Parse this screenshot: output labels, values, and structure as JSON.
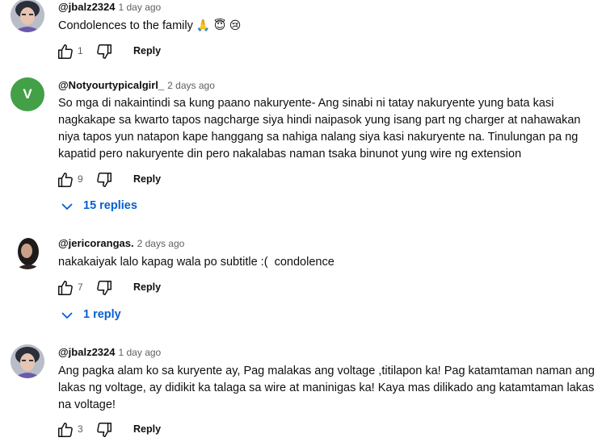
{
  "comments": [
    {
      "author": "@jbalz2324",
      "time": "1 day ago",
      "text": "Condolences to the family",
      "emojis": "🙏 😇 😢",
      "likes": "1",
      "reply_label": "Reply",
      "avatar_icon": "profile-photo"
    },
    {
      "author": "@Notyourtypicalgirl_",
      "time": "2 days ago",
      "avatar_letter": "V",
      "avatar_color": "#43a047",
      "text_lines": [
        "So mga di nakaintindi sa kung paano nakuryente- Ang sinabi ni tatay nakuryente yung bata kasi",
        "nagkakape sa kwarto tapos nagcharge siya hindi naipasok yung isang part ng charger at nahawakan",
        "niya tapos yun natapon kape hanggang sa nahiga nalang siya kasi nakuryente na. Tinulungan pa ng",
        "kapatid pero nakuryente din pero nakalabas naman tsaka binunot yung wire ng extension"
      ],
      "likes": "9",
      "reply_label": "Reply",
      "replies_label": "15 replies"
    },
    {
      "author": "@jericorangas.",
      "time": "2 days ago",
      "text": "nakakaiyak lalo kapag wala po subtitle :(  condolence",
      "likes": "7",
      "reply_label": "Reply",
      "replies_label": "1 reply",
      "avatar_icon": "profile-photo"
    },
    {
      "author": "@jbalz2324",
      "time": "1 day ago",
      "text_lines": [
        "Ang pagka alam ko sa kuryente ay, Pag malakas ang voltage ,titilapon ka! Pag katamtaman naman ang",
        "lakas ng voltage, ay didikit ka talaga sa wire at maninigas ka! Kaya mas dilikado ang katamtaman lakas",
        "na voltage!"
      ],
      "likes": "3",
      "reply_label": "Reply",
      "avatar_icon": "profile-photo"
    }
  ],
  "colors": {
    "link_blue": "#065fd4",
    "meta_gray": "#606060",
    "text": "#0f0f0f"
  }
}
